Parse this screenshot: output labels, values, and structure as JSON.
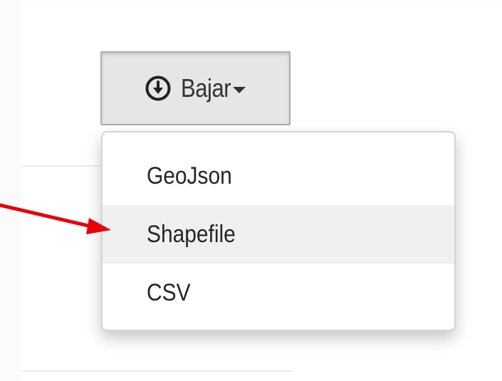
{
  "download_button": {
    "label": "Bajar",
    "icon": "download-circle-icon"
  },
  "dropdown": {
    "items": [
      {
        "label": "GeoJson",
        "active": false
      },
      {
        "label": "Shapefile",
        "active": true
      },
      {
        "label": "CSV",
        "active": false
      }
    ]
  },
  "annotation": {
    "arrow_color": "#e8000b",
    "target": "Shapefile"
  },
  "colors": {
    "button_bg": "#e6e6e6",
    "button_border": "#adadad",
    "menu_hover": "#f0f0f0",
    "text": "#333333"
  }
}
